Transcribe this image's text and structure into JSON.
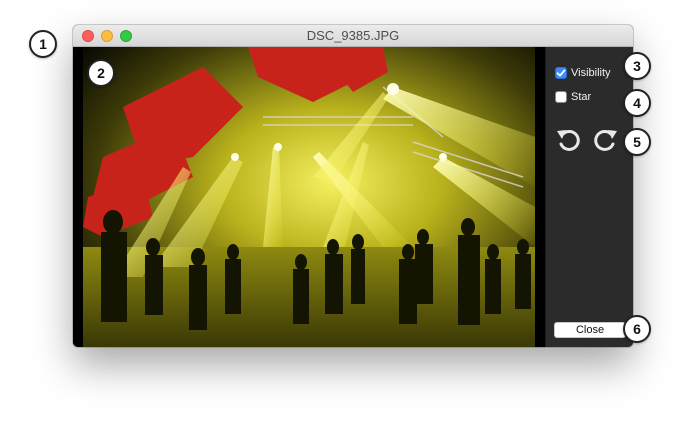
{
  "window": {
    "title": "DSC_9385.JPG"
  },
  "image": {
    "subject": "concert-photo"
  },
  "side_panel": {
    "visibility_label": "Visibility",
    "visibility_checked": true,
    "star_label": "Star",
    "star_checked": false,
    "rotate_left_icon": "rotate-left-icon",
    "rotate_right_icon": "rotate-right-icon",
    "close_label": "Close"
  },
  "callouts": [
    "1",
    "2",
    "3",
    "4",
    "5",
    "6"
  ],
  "colors": {
    "close_dot": "#fc605c",
    "minimize_dot": "#fdbc40",
    "zoom_dot": "#34c84a",
    "checkbox_accent": "#3b8cf6",
    "panel_bg": "#2b2b2b"
  }
}
